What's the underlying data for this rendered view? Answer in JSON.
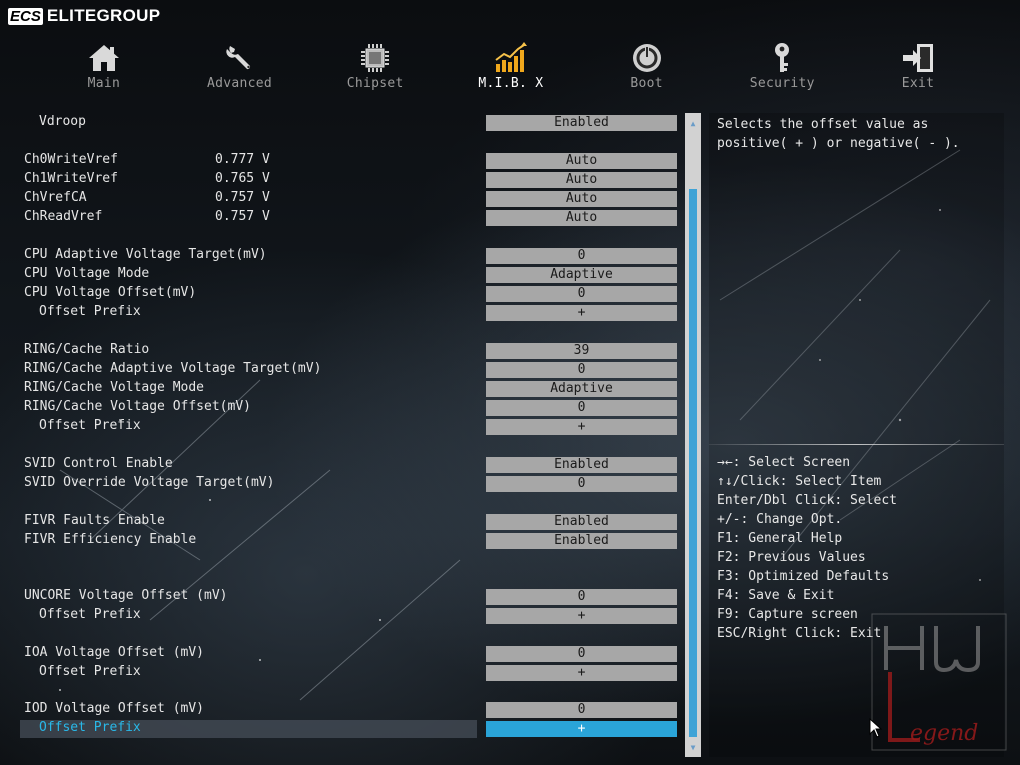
{
  "brand": {
    "logo": "ECS",
    "name": "ELITEGROUP"
  },
  "nav": [
    {
      "label": "Main",
      "icon": "home-icon",
      "active": false
    },
    {
      "label": "Advanced",
      "icon": "wrench-icon",
      "active": false
    },
    {
      "label": "Chipset",
      "icon": "chip-icon",
      "active": false
    },
    {
      "label": "M.I.B. X",
      "icon": "performance-chart-icon",
      "active": true
    },
    {
      "label": "Boot",
      "icon": "power-icon",
      "active": false
    },
    {
      "label": "Security",
      "icon": "key-icon",
      "active": false
    },
    {
      "label": "Exit",
      "icon": "exit-door-icon",
      "active": false
    }
  ],
  "settings": [
    {
      "label": "Vdroop",
      "indent": true,
      "reading": "",
      "value": "Enabled"
    },
    {
      "label": "Ch0WriteVref",
      "indent": false,
      "reading": "0.777 V",
      "value": "Auto"
    },
    {
      "label": "Ch1WriteVref",
      "indent": false,
      "reading": "0.765 V",
      "value": "Auto"
    },
    {
      "label": "ChVrefCA",
      "indent": false,
      "reading": "0.757 V",
      "value": "Auto"
    },
    {
      "label": "ChReadVref",
      "indent": false,
      "reading": "0.757 V",
      "value": "Auto"
    },
    {
      "label": "CPU Adaptive Voltage Target(mV)",
      "indent": false,
      "reading": "",
      "value": "0"
    },
    {
      "label": "CPU Voltage Mode",
      "indent": false,
      "reading": "",
      "value": "Adaptive"
    },
    {
      "label": "CPU Voltage Offset(mV)",
      "indent": false,
      "reading": "",
      "value": "0"
    },
    {
      "label": "Offset Prefix",
      "indent": true,
      "reading": "",
      "value": "+"
    },
    {
      "label": "RING/Cache Ratio",
      "indent": false,
      "reading": "",
      "value": "39"
    },
    {
      "label": "RING/Cache Adaptive Voltage Target(mV)",
      "indent": false,
      "reading": "",
      "value": "0"
    },
    {
      "label": "RING/Cache Voltage Mode",
      "indent": false,
      "reading": "",
      "value": "Adaptive"
    },
    {
      "label": "RING/Cache Voltage Offset(mV)",
      "indent": false,
      "reading": "",
      "value": "0"
    },
    {
      "label": "Offset Prefix",
      "indent": true,
      "reading": "",
      "value": "+"
    },
    {
      "label": "SVID Control Enable",
      "indent": false,
      "reading": "",
      "value": "Enabled"
    },
    {
      "label": "SVID Override Voltage Target(mV)",
      "indent": false,
      "reading": "",
      "value": "0"
    },
    {
      "label": "FIVR Faults Enable",
      "indent": false,
      "reading": "",
      "value": "Enabled"
    },
    {
      "label": "FIVR Efficiency Enable",
      "indent": false,
      "reading": "",
      "value": "Enabled"
    },
    {
      "label": "UNCORE Voltage Offset (mV)",
      "indent": false,
      "reading": "",
      "value": "0"
    },
    {
      "label": "Offset Prefix",
      "indent": true,
      "reading": "",
      "value": "+"
    },
    {
      "label": "IOA Voltage Offset (mV)",
      "indent": false,
      "reading": "",
      "value": "0"
    },
    {
      "label": "Offset Prefix",
      "indent": true,
      "reading": "",
      "value": "+"
    },
    {
      "label": "IOD Voltage Offset (mV)",
      "indent": false,
      "reading": "",
      "value": "0"
    },
    {
      "label": "Offset Prefix",
      "indent": true,
      "reading": "",
      "value": "+",
      "selected": true
    }
  ],
  "help": {
    "description": "Selects the offset value as\npositive( + ) or negative( - ).",
    "keys": [
      "→←: Select Screen",
      "↑↓/Click: Select Item",
      "Enter/Dbl Click: Select",
      "+/-: Change Opt.",
      "F1: General Help",
      "F2: Previous Values",
      "F3: Optimized Defaults",
      "F4: Save & Exit",
      "F9: Capture screen",
      "ESC/Right Click: Exit"
    ]
  },
  "watermark": "HW Legend",
  "colors": {
    "accent": "#2aa4d8",
    "value_bg": "#a7a7a7",
    "selected_label": "#29b8e8"
  }
}
